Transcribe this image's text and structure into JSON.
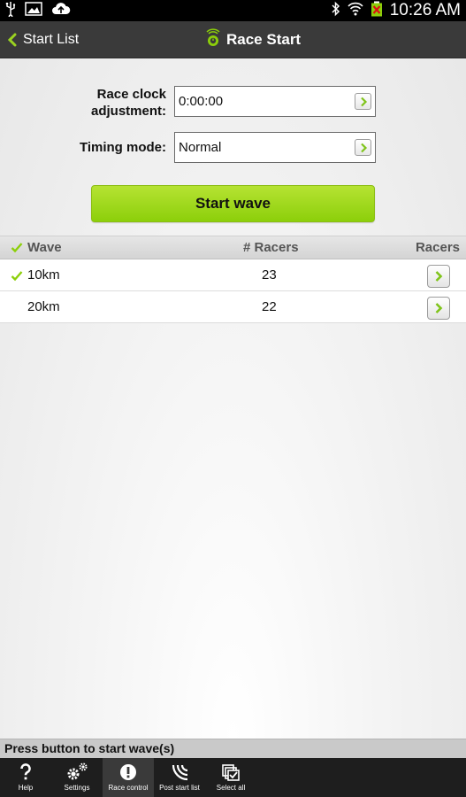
{
  "actionbar": {
    "back_label": "Start List",
    "title": "Race Start"
  },
  "statusbar": {
    "time": "10:26 AM"
  },
  "form": {
    "clock_label_line1": "Race clock",
    "clock_label_line2": "adjustment:",
    "clock_value": "0:00:00",
    "timing_label": "Timing mode:",
    "timing_value": "Normal",
    "start_button": "Start wave"
  },
  "table": {
    "headers": {
      "wave": "Wave",
      "racers_count": "# Racers",
      "racers": "Racers"
    },
    "rows": [
      {
        "wave": "10km",
        "count": "23",
        "checked": true
      },
      {
        "wave": "20km",
        "count": "22",
        "checked": false
      }
    ]
  },
  "status_message": "Press button to start wave(s)",
  "toolbar": {
    "items": [
      {
        "label": "Help",
        "icon": "help-icon",
        "active": false
      },
      {
        "label": "Settings",
        "icon": "settings-icon",
        "active": false
      },
      {
        "label": "Race control",
        "icon": "alert-icon",
        "active": true
      },
      {
        "label": "Post start list",
        "icon": "broadcast-icon",
        "active": false
      },
      {
        "label": "Select all",
        "icon": "select-all-icon",
        "active": false
      }
    ]
  },
  "colors": {
    "accent_green": "#8ccf0a",
    "actionbar_bg": "#3a3a3a",
    "toolbar_bg": "#1e1e1e"
  }
}
